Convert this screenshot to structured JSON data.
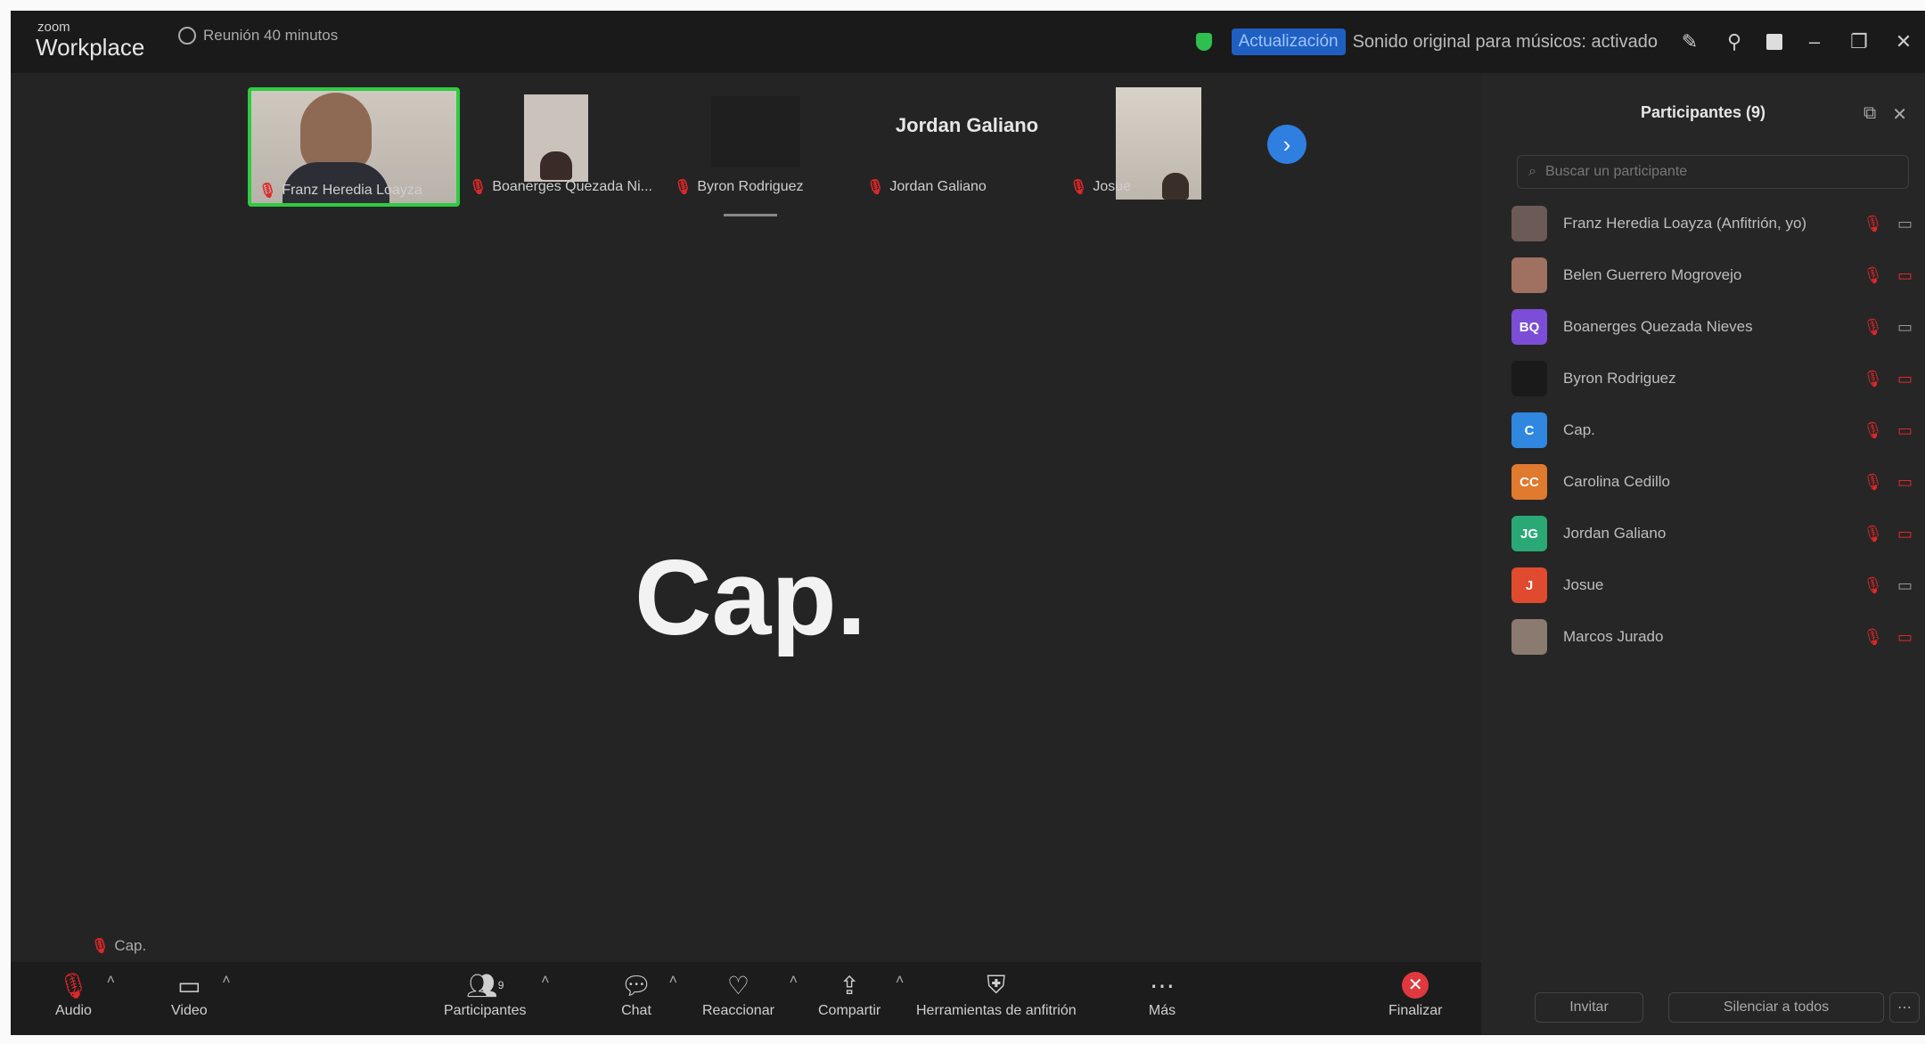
{
  "app": {
    "logo_small": "zoom",
    "logo_big": "Workplace",
    "timer": "Reunión 40 minutos"
  },
  "titlebar": {
    "update_pill": "Actualización",
    "status_text": "Sonido original para músicos: activado"
  },
  "thumbnails": [
    {
      "name": "Franz Heredia Loayza"
    },
    {
      "name": "Boanerges Quezada Ni..."
    },
    {
      "name": "Byron Rodriguez"
    },
    {
      "display_name": "Jordan Galiano",
      "name": "Jordan Galiano"
    },
    {
      "name": "Josue"
    }
  ],
  "stage": {
    "big_name": "Cap.",
    "label": "Cap."
  },
  "toolbar": {
    "audio": "Audio",
    "video": "Video",
    "participants": "Participantes",
    "participants_count": "9",
    "chat": "Chat",
    "react": "Reaccionar",
    "share": "Compartir",
    "host_tools": "Herramientas de anfitrión",
    "more": "Más",
    "end": "Finalizar"
  },
  "panel": {
    "title": "Participantes (9)",
    "search_placeholder": "Buscar un participante",
    "invite": "Invitar",
    "mute_all": "Silenciar a todos",
    "participants": [
      {
        "name": "Franz Heredia Loayza (Anfitrión, yo)",
        "initials": "",
        "color": "#6b5a55",
        "camera_on": true
      },
      {
        "name": "Belen Guerrero Mogrovejo",
        "initials": "",
        "color": "#a07060",
        "camera_on": false
      },
      {
        "name": "Boanerges Quezada Nieves",
        "initials": "BQ",
        "color": "#7c4dd6",
        "camera_on": true
      },
      {
        "name": "Byron Rodriguez",
        "initials": "",
        "color": "#1a1a1a",
        "camera_on": false
      },
      {
        "name": "Cap.",
        "initials": "C",
        "color": "#2f87e0",
        "camera_on": false
      },
      {
        "name": "Carolina Cedillo",
        "initials": "CC",
        "color": "#e07a2f",
        "camera_on": false
      },
      {
        "name": "Jordan Galiano",
        "initials": "JG",
        "color": "#2aa876",
        "camera_on": false
      },
      {
        "name": "Josue",
        "initials": "J",
        "color": "#e04a2f",
        "camera_on": true
      },
      {
        "name": "Marcos Jurado",
        "initials": "",
        "color": "#8a7a70",
        "camera_on": false
      }
    ]
  }
}
